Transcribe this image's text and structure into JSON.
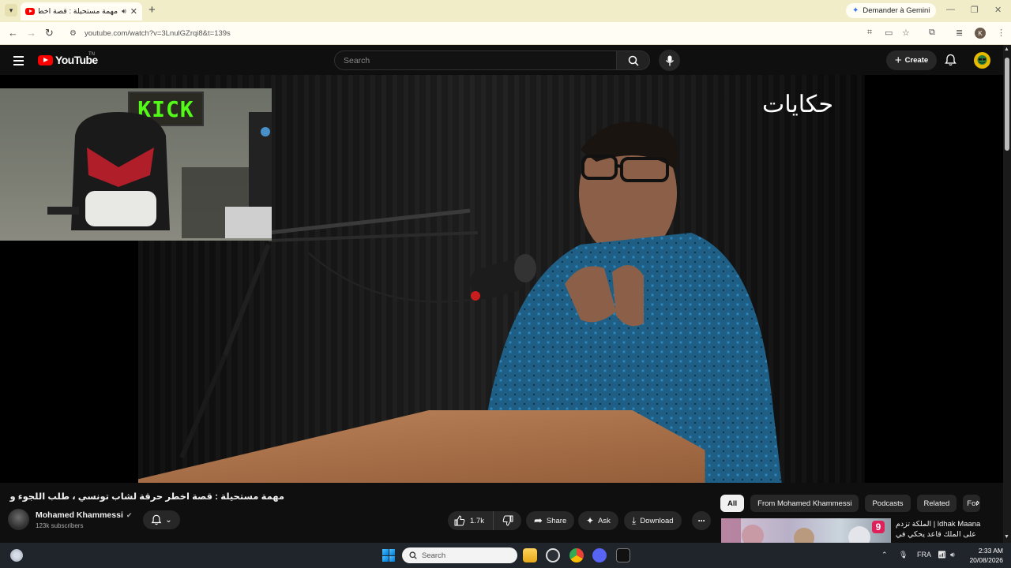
{
  "browser": {
    "tab_title": "مهمة مستحيلة : قصة اخطر حرقة لشاب تونسي ، طلب اللجوء و تجربة السجن !",
    "new_tab": "+",
    "gemini_label": "Demander à Gemini",
    "url": "youtube.com/watch?v=3LnulGZrqi8&t=139s",
    "profile_initial": "K"
  },
  "youtube": {
    "logo_text": "YouTube",
    "logo_suffix": "TN",
    "search_placeholder": "Search",
    "create_label": "Create"
  },
  "video": {
    "watermark": "حكايات",
    "webcam_sign": "KICK",
    "title": "مهمة مستحيلة : قصة اخطر حرقة لشاب تونسي ، طلب اللجوء و تجربة السجن !",
    "channel_name": "Mohamed Khammessi",
    "subscribers": "123k subscribers",
    "like_count": "1.7k",
    "share_label": "Share",
    "ask_label": "Ask",
    "download_label": "Download"
  },
  "chips": [
    "All",
    "From Mohamed Khammessi",
    "Podcasts",
    "Related",
    "For y"
  ],
  "recommendation": {
    "title": "ldhak Maana | الملكة تزدم على الملك قاعد يحكي في جواري",
    "badge": "9"
  },
  "taskbar": {
    "search_placeholder": "Search",
    "language": "FRA",
    "time": "2:33 AM",
    "date": "20/08/2026"
  },
  "colors": {
    "youtube_red": "#ff0000",
    "background": "#0f0f0f",
    "kick_green": "#53fc18",
    "tabstrip": "#f2edc9"
  }
}
